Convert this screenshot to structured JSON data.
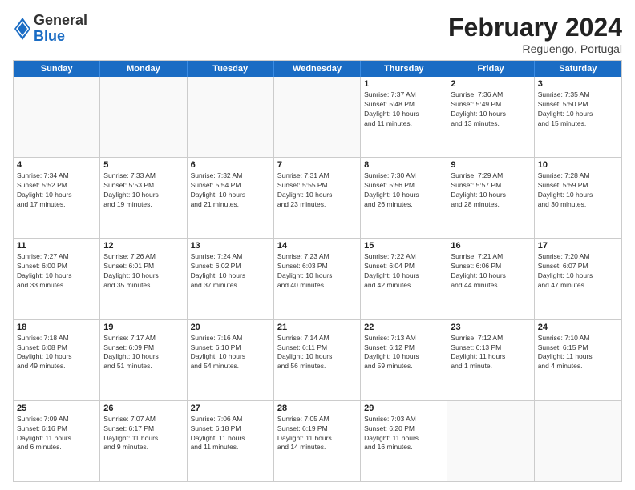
{
  "header": {
    "logo_general": "General",
    "logo_blue": "Blue",
    "month_title": "February 2024",
    "location": "Reguengo, Portugal"
  },
  "weekdays": [
    "Sunday",
    "Monday",
    "Tuesday",
    "Wednesday",
    "Thursday",
    "Friday",
    "Saturday"
  ],
  "weeks": [
    [
      {
        "day": "",
        "info": ""
      },
      {
        "day": "",
        "info": ""
      },
      {
        "day": "",
        "info": ""
      },
      {
        "day": "",
        "info": ""
      },
      {
        "day": "1",
        "info": "Sunrise: 7:37 AM\nSunset: 5:48 PM\nDaylight: 10 hours\nand 11 minutes."
      },
      {
        "day": "2",
        "info": "Sunrise: 7:36 AM\nSunset: 5:49 PM\nDaylight: 10 hours\nand 13 minutes."
      },
      {
        "day": "3",
        "info": "Sunrise: 7:35 AM\nSunset: 5:50 PM\nDaylight: 10 hours\nand 15 minutes."
      }
    ],
    [
      {
        "day": "4",
        "info": "Sunrise: 7:34 AM\nSunset: 5:52 PM\nDaylight: 10 hours\nand 17 minutes."
      },
      {
        "day": "5",
        "info": "Sunrise: 7:33 AM\nSunset: 5:53 PM\nDaylight: 10 hours\nand 19 minutes."
      },
      {
        "day": "6",
        "info": "Sunrise: 7:32 AM\nSunset: 5:54 PM\nDaylight: 10 hours\nand 21 minutes."
      },
      {
        "day": "7",
        "info": "Sunrise: 7:31 AM\nSunset: 5:55 PM\nDaylight: 10 hours\nand 23 minutes."
      },
      {
        "day": "8",
        "info": "Sunrise: 7:30 AM\nSunset: 5:56 PM\nDaylight: 10 hours\nand 26 minutes."
      },
      {
        "day": "9",
        "info": "Sunrise: 7:29 AM\nSunset: 5:57 PM\nDaylight: 10 hours\nand 28 minutes."
      },
      {
        "day": "10",
        "info": "Sunrise: 7:28 AM\nSunset: 5:59 PM\nDaylight: 10 hours\nand 30 minutes."
      }
    ],
    [
      {
        "day": "11",
        "info": "Sunrise: 7:27 AM\nSunset: 6:00 PM\nDaylight: 10 hours\nand 33 minutes."
      },
      {
        "day": "12",
        "info": "Sunrise: 7:26 AM\nSunset: 6:01 PM\nDaylight: 10 hours\nand 35 minutes."
      },
      {
        "day": "13",
        "info": "Sunrise: 7:24 AM\nSunset: 6:02 PM\nDaylight: 10 hours\nand 37 minutes."
      },
      {
        "day": "14",
        "info": "Sunrise: 7:23 AM\nSunset: 6:03 PM\nDaylight: 10 hours\nand 40 minutes."
      },
      {
        "day": "15",
        "info": "Sunrise: 7:22 AM\nSunset: 6:04 PM\nDaylight: 10 hours\nand 42 minutes."
      },
      {
        "day": "16",
        "info": "Sunrise: 7:21 AM\nSunset: 6:06 PM\nDaylight: 10 hours\nand 44 minutes."
      },
      {
        "day": "17",
        "info": "Sunrise: 7:20 AM\nSunset: 6:07 PM\nDaylight: 10 hours\nand 47 minutes."
      }
    ],
    [
      {
        "day": "18",
        "info": "Sunrise: 7:18 AM\nSunset: 6:08 PM\nDaylight: 10 hours\nand 49 minutes."
      },
      {
        "day": "19",
        "info": "Sunrise: 7:17 AM\nSunset: 6:09 PM\nDaylight: 10 hours\nand 51 minutes."
      },
      {
        "day": "20",
        "info": "Sunrise: 7:16 AM\nSunset: 6:10 PM\nDaylight: 10 hours\nand 54 minutes."
      },
      {
        "day": "21",
        "info": "Sunrise: 7:14 AM\nSunset: 6:11 PM\nDaylight: 10 hours\nand 56 minutes."
      },
      {
        "day": "22",
        "info": "Sunrise: 7:13 AM\nSunset: 6:12 PM\nDaylight: 10 hours\nand 59 minutes."
      },
      {
        "day": "23",
        "info": "Sunrise: 7:12 AM\nSunset: 6:13 PM\nDaylight: 11 hours\nand 1 minute."
      },
      {
        "day": "24",
        "info": "Sunrise: 7:10 AM\nSunset: 6:15 PM\nDaylight: 11 hours\nand 4 minutes."
      }
    ],
    [
      {
        "day": "25",
        "info": "Sunrise: 7:09 AM\nSunset: 6:16 PM\nDaylight: 11 hours\nand 6 minutes."
      },
      {
        "day": "26",
        "info": "Sunrise: 7:07 AM\nSunset: 6:17 PM\nDaylight: 11 hours\nand 9 minutes."
      },
      {
        "day": "27",
        "info": "Sunrise: 7:06 AM\nSunset: 6:18 PM\nDaylight: 11 hours\nand 11 minutes."
      },
      {
        "day": "28",
        "info": "Sunrise: 7:05 AM\nSunset: 6:19 PM\nDaylight: 11 hours\nand 14 minutes."
      },
      {
        "day": "29",
        "info": "Sunrise: 7:03 AM\nSunset: 6:20 PM\nDaylight: 11 hours\nand 16 minutes."
      },
      {
        "day": "",
        "info": ""
      },
      {
        "day": "",
        "info": ""
      }
    ]
  ]
}
